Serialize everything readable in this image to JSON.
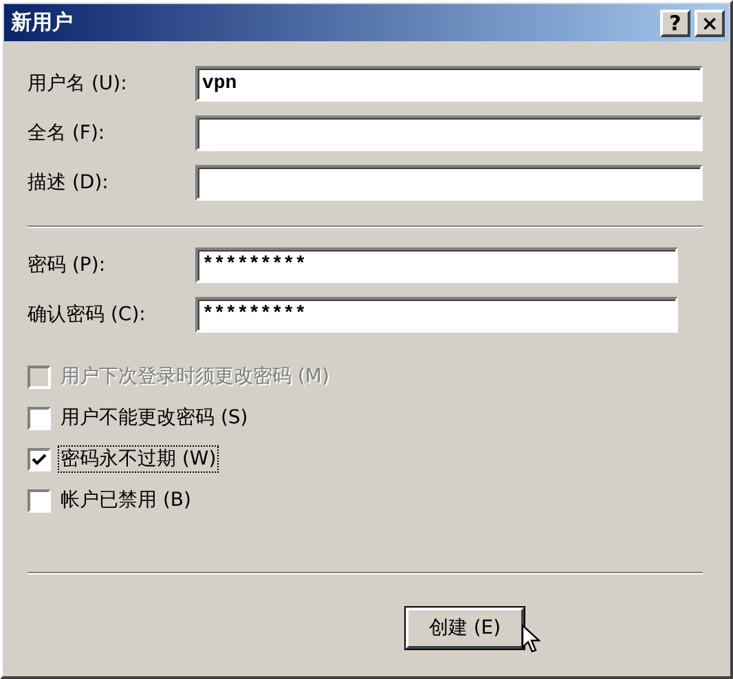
{
  "window": {
    "title": "新用户",
    "help_button": "?",
    "close_button": "×"
  },
  "fields": [
    {
      "label": "用户名 (U):",
      "value": "vpn"
    },
    {
      "label": "全名 (F):"
    },
    {
      "label": "描述 (D):"
    }
  ],
  "password_fields": [
    {
      "label": "密码 (P):",
      "value": "*********"
    },
    {
      "label": "确认密码 (C):",
      "value": "*********"
    }
  ],
  "options": [
    {
      "label": "用户下次登录时须更改密码 (M)",
      "checked": false,
      "disabled": true,
      "focused": false
    },
    {
      "label": "用户不能更改密码 (S)",
      "checked": false,
      "disabled": false,
      "focused": false
    },
    {
      "label": "密码永不过期 (W)",
      "checked": true,
      "disabled": false,
      "focused": true
    },
    {
      "label": "帐户已禁用 (B)",
      "checked": false,
      "disabled": false,
      "focused": false
    }
  ],
  "buttons": [
    "创建 (E)"
  ]
}
